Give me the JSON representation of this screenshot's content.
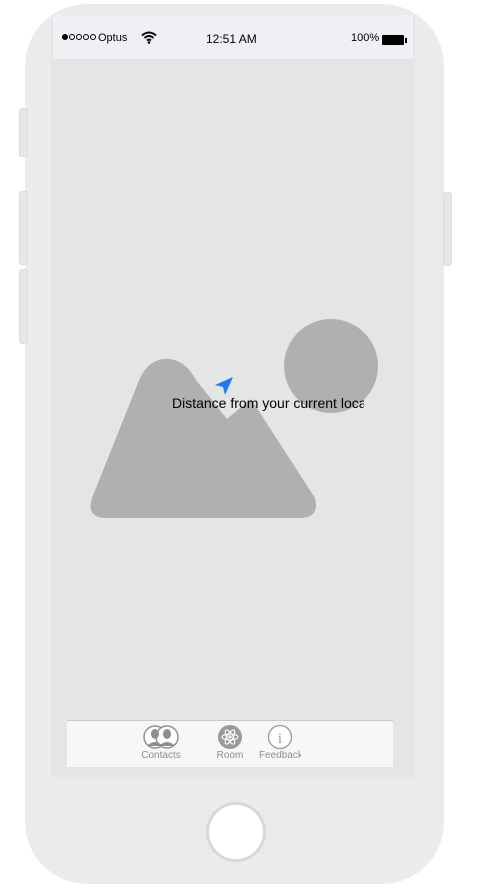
{
  "status_bar": {
    "carrier": "Optus",
    "time": "12:51 AM",
    "battery_percent": "100%",
    "signal_bars_filled": 1,
    "signal_bars_total": 5
  },
  "content": {
    "distance_label": "Distance from your current loca",
    "location_icon": "location-arrow-icon",
    "image_placeholder_icon": "image-placeholder-icon"
  },
  "tab_bar": {
    "tabs": [
      {
        "label": "Contacts",
        "icon": "contacts-icon"
      },
      {
        "label": "Room",
        "icon": "atom-icon"
      },
      {
        "label": "Feedback",
        "icon": "info-icon"
      }
    ]
  },
  "colors": {
    "accent": "#1a7cf0",
    "screen_bg": "#e5e5e5",
    "placeholder": "#b0b0b0"
  }
}
